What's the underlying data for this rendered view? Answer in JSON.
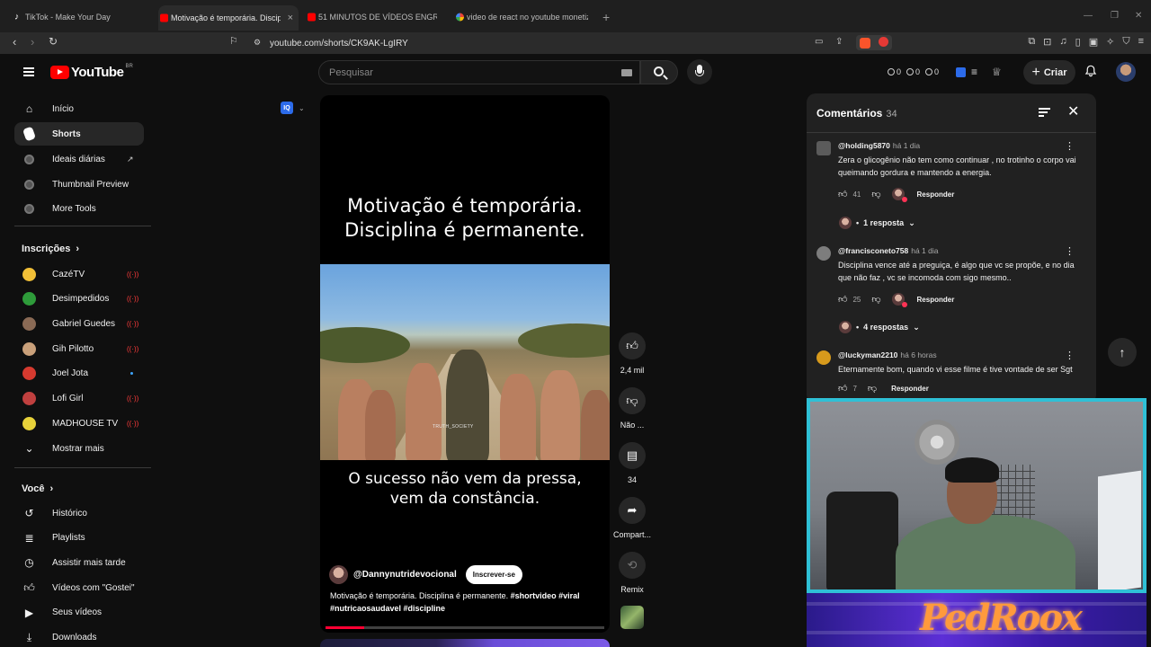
{
  "browser": {
    "tabs": [
      {
        "title": "TikTok - Make Your Day",
        "favicon": "tiktok-icon"
      },
      {
        "title": "Motivação é temporária. Disciplin",
        "favicon": "youtube-icon",
        "active": true
      },
      {
        "title": "51 MINUTOS DE VÍDEOS ENGRAÇAD",
        "favicon": "youtube-icon"
      },
      {
        "title": "video de react no youtube monetiza",
        "favicon": "google-icon"
      }
    ],
    "url": "youtube.com/shorts/CK9AK-LgIRY"
  },
  "header": {
    "logo_text": "YouTube",
    "region": "BR",
    "search_placeholder": "Pesquisar",
    "counters": [
      "0",
      "0",
      "0"
    ],
    "create_label": "Criar"
  },
  "sidebar": {
    "main": [
      {
        "label": "Início",
        "icon": "home-icon"
      },
      {
        "label": "Shorts",
        "icon": "shorts-icon",
        "active": true
      },
      {
        "label": "Ideais diárias",
        "icon": "extension-icon",
        "external": true
      },
      {
        "label": "Thumbnail Preview",
        "icon": "extension-icon"
      },
      {
        "label": "More Tools",
        "icon": "extension-icon"
      }
    ],
    "subscriptions_title": "Inscrições",
    "subscriptions": [
      {
        "label": "CazéTV",
        "color": "#f2c037",
        "status": "live"
      },
      {
        "label": "Desimpedidos",
        "color": "#2e9b3a",
        "status": "live"
      },
      {
        "label": "Gabriel Guedes",
        "color": "#8a6a55",
        "status": "live"
      },
      {
        "label": "Gih Pilotto",
        "color": "#c9a07a",
        "status": "live"
      },
      {
        "label": "Joel Jota",
        "color": "#d63a2f",
        "status": "new"
      },
      {
        "label": "Lofi Girl",
        "color": "#c0403f",
        "status": "live"
      },
      {
        "label": "MADHOUSE TV",
        "color": "#e7d23a",
        "status": "live"
      }
    ],
    "show_more": "Mostrar mais",
    "you_title": "Você",
    "you": [
      {
        "label": "Histórico",
        "icon": "history-icon"
      },
      {
        "label": "Playlists",
        "icon": "playlist-icon"
      },
      {
        "label": "Assistir mais tarde",
        "icon": "clock-icon"
      },
      {
        "label": "Vídeos com \"Gostei\"",
        "icon": "thumbs-up-icon"
      },
      {
        "label": "Seus vídeos",
        "icon": "video-icon"
      },
      {
        "label": "Downloads",
        "icon": "download-icon"
      }
    ]
  },
  "short": {
    "quote_top_line1": "Motivação é temporária.",
    "quote_top_line2": "Disciplina é permanente.",
    "quote_bottom_line1": "O sucesso não vem da pressa,",
    "quote_bottom_line2": "vem da constância.",
    "watermark": "TRUTH_SOCIETY",
    "channel": "@Dannynutridevocional",
    "subscribe_label": "Inscrever-se",
    "caption_text": "Motivação é temporária. Disciplina é permanente. ",
    "caption_tags1": "#shortvideo #viral",
    "caption_tags2": "#nutricaosaudavel #discipline",
    "progress": 0.14
  },
  "actions": {
    "likes": "2,4 mil",
    "dislike_label": "Não ...",
    "comments": "34",
    "share_label": "Compart...",
    "remix_label": "Remix"
  },
  "comments": {
    "title": "Comentários",
    "count": "34",
    "items": [
      {
        "user": "@holding5870",
        "time": "há 1 dia",
        "text": "Zera o glicogênio não tem como continuar , no trotinho o corpo vai queimando gordura e mantendo a energia.",
        "likes": "41",
        "reply_label": "Responder",
        "replies_label": "1 resposta",
        "avatar_color": "#5b5b5b"
      },
      {
        "user": "@francisconeto758",
        "time": "há 1 dia",
        "text": "Disciplina vence até a preguiça, é algo que vc se propõe, e no dia que não faz , vc se incomoda com sigo mesmo..",
        "likes": "25",
        "reply_label": "Responder",
        "replies_label": "4 respostas",
        "avatar_color": "#7d7d7d"
      },
      {
        "user": "@luckyman2210",
        "time": "há 6 horas",
        "text": "Eternamente bom, quando vi esse filme é tive vontade de ser Sgt",
        "likes": "7",
        "reply_label": "Responder",
        "avatar_color": "#d79a1c"
      }
    ]
  },
  "overlay": {
    "banner_logo": "PedRoox"
  }
}
